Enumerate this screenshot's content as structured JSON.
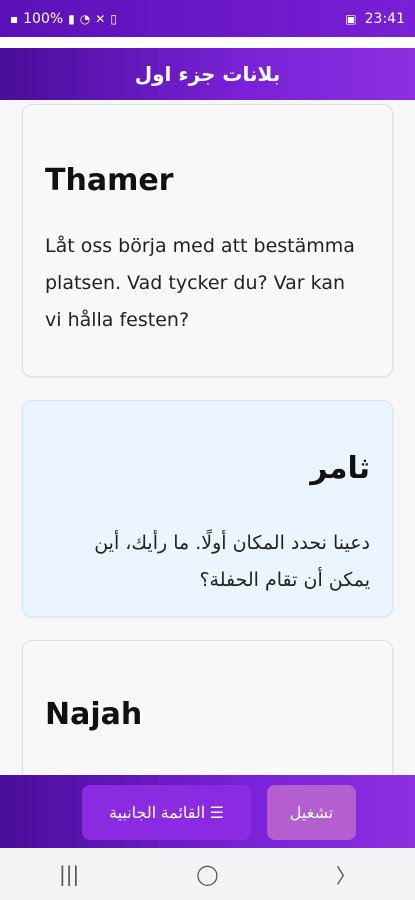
{
  "status_bar": {
    "battery_percent": "100%",
    "time": "23:41",
    "icons": [
      "notification-dot-icon",
      "battery-icon",
      "signal-icon",
      "wifi-icon",
      "mute-icon",
      "battery-small-icon",
      "gallery-icon"
    ]
  },
  "app_bar": {
    "title": "بلانات جزء اول"
  },
  "cards": [
    {
      "name": "Thamer",
      "text_lines": [
        "Låt oss börja med att bestämma",
        "platsen. Vad tycker du? Var kan",
        "vi hålla festen?"
      ],
      "lang": "sv"
    },
    {
      "name": "ثامر",
      "text_lines": [
        "دعينا نحدد المكان أولًا. ما رأيك، أين",
        "يمكن أن تقام الحفلة؟"
      ],
      "lang": "ar"
    },
    {
      "name": "Najah",
      "text_lines": [],
      "lang": "sv"
    }
  ],
  "bottom_bar": {
    "menu_label": "القائمة الجانبية ☰",
    "play_label": "تشغيل"
  },
  "nav_bar": {
    "recents": "|||",
    "home": "◯",
    "back": "〉"
  }
}
